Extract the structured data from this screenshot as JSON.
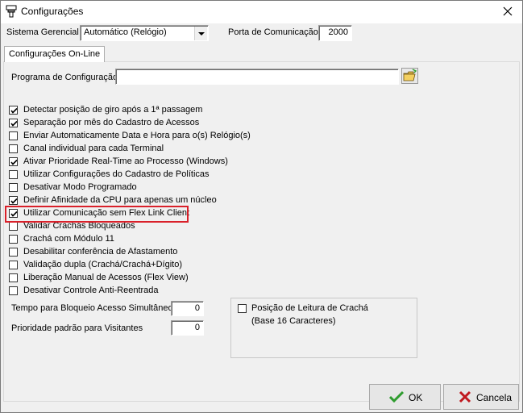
{
  "window": {
    "title": "Configurações"
  },
  "header": {
    "sistema_label": "Sistema Gerencial",
    "sistema_value": "Automático (Relógio)",
    "porta_label": "Porta de Comunicação",
    "porta_value": "2000"
  },
  "tab": {
    "label": "Configurações On-Line"
  },
  "programa": {
    "label": "Programa de Configuração",
    "value": ""
  },
  "checkboxes": [
    {
      "label": "Detectar posição de giro após a 1ª passagem",
      "checked": true
    },
    {
      "label": "Separação por mês do Cadastro de Acessos",
      "checked": true
    },
    {
      "label": "Enviar Automaticamente Data e Hora para o(s) Relógio(s)",
      "checked": false
    },
    {
      "label": "Canal individual para cada Terminal",
      "checked": false
    },
    {
      "label": "Ativar Prioridade Real-Time ao Processo (Windows)",
      "checked": true
    },
    {
      "label": "Utilizar Configurações do Cadastro de Políticas",
      "checked": false
    },
    {
      "label": "Desativar Modo Programado",
      "checked": false
    },
    {
      "label": "Definir Afinidade da CPU para apenas um núcleo",
      "checked": true
    },
    {
      "label": "Utilizar Comunicação sem Flex Link Client",
      "checked": true
    },
    {
      "label": "Validar Crachás Bloqueados",
      "checked": false
    },
    {
      "label": "Crachá com Módulo 11",
      "checked": false
    },
    {
      "label": "Desabilitar conferência de Afastamento",
      "checked": false
    },
    {
      "label": "Validação dupla (Crachá/Crachá+Dígito)",
      "checked": false
    },
    {
      "label": "Liberação Manual de Acessos (Flex View)",
      "checked": false
    },
    {
      "label": "Desativar Controle Anti-Reentrada",
      "checked": false
    }
  ],
  "tempo": {
    "label": "Tempo para Bloqueio Acesso Simultâneo",
    "value": "0"
  },
  "prioridade": {
    "label": "Prioridade padrão para Visitantes",
    "value": "0"
  },
  "posicao": {
    "label_line1": "Posição de Leitura de Crachá",
    "label_line2": "(Base 16 Caracteres)",
    "checked": false
  },
  "buttons": {
    "ok": "OK",
    "cancel": "Cancela"
  },
  "colors": {
    "highlight": "#d9202a",
    "ok_check": "#2e9c2e",
    "cancel_x": "#c0181e"
  }
}
